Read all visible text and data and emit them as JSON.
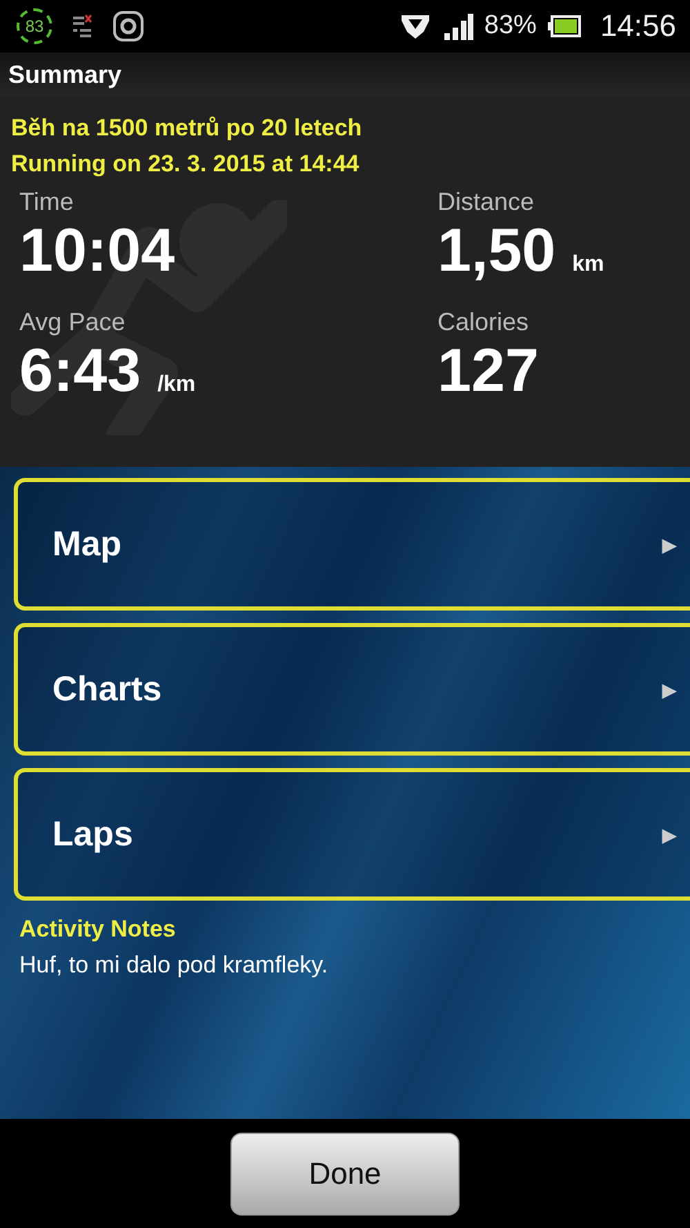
{
  "status_bar": {
    "notification_count": "83",
    "battery_percent": "83%",
    "time": "14:56"
  },
  "header": {
    "title": "Summary"
  },
  "activity": {
    "name": "Běh na 1500 metrů po 20 letech",
    "subtitle": "Running on 23. 3. 2015 at 14:44",
    "stats": [
      {
        "label": "Time",
        "value": "10:04"
      },
      {
        "label": "Distance",
        "value": "1,50",
        "unit": "km"
      },
      {
        "label": "Avg Pace",
        "value": "6:43",
        "unit": "/km"
      },
      {
        "label": "Calories",
        "value": "127"
      }
    ]
  },
  "menu": [
    {
      "label": "Map",
      "arrow": "▶"
    },
    {
      "label": "Charts",
      "arrow": "▶"
    },
    {
      "label": "Laps",
      "arrow": "▶"
    }
  ],
  "notes": {
    "title": "Activity Notes",
    "text": "Huf, to mi dalo pod kramfleky."
  },
  "footer": {
    "button": "Done"
  }
}
